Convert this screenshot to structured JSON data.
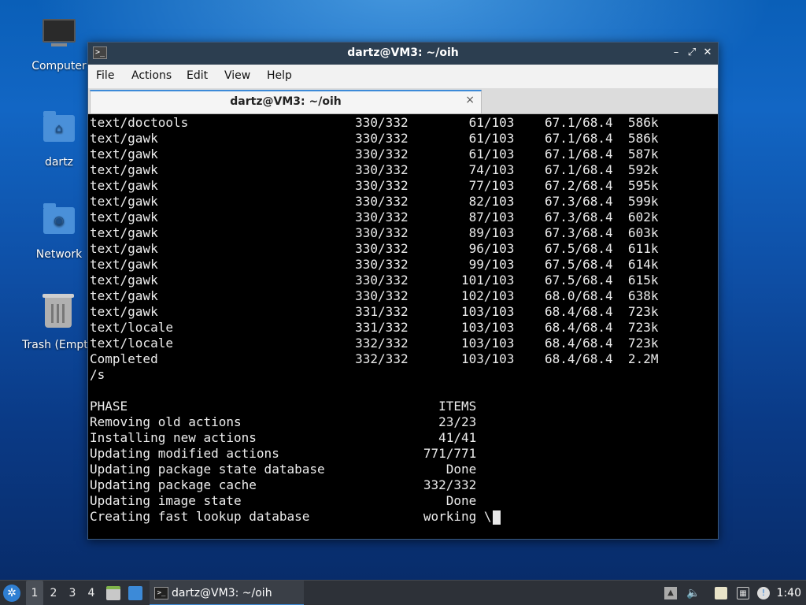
{
  "desktop": {
    "icons": [
      {
        "label": "Computer"
      },
      {
        "label": "dartz"
      },
      {
        "label": "Network"
      },
      {
        "label": "Trash (Empty)"
      }
    ]
  },
  "window": {
    "title": "dartz@VM3: ~/oih",
    "menu": [
      "File",
      "Actions",
      "Edit",
      "View",
      "Help"
    ],
    "tab_label": "dartz@VM3: ~/oih",
    "tab_close": "×",
    "controls": {
      "minimize": "–",
      "maximize": "⤢",
      "close": "✕"
    }
  },
  "terminal": {
    "lines": [
      "text/doctools                      330/332        61/103    67.1/68.4  586k",
      "text/gawk                          330/332        61/103    67.1/68.4  586k",
      "text/gawk                          330/332        61/103    67.1/68.4  587k",
      "text/gawk                          330/332        74/103    67.1/68.4  592k",
      "text/gawk                          330/332        77/103    67.2/68.4  595k",
      "text/gawk                          330/332        82/103    67.3/68.4  599k",
      "text/gawk                          330/332        87/103    67.3/68.4  602k",
      "text/gawk                          330/332        89/103    67.3/68.4  603k",
      "text/gawk                          330/332        96/103    67.5/68.4  611k",
      "text/gawk                          330/332        99/103    67.5/68.4  614k",
      "text/gawk                          330/332       101/103    67.5/68.4  615k",
      "text/gawk                          330/332       102/103    68.0/68.4  638k",
      "text/gawk                          331/332       103/103    68.4/68.4  723k",
      "text/locale                        331/332       103/103    68.4/68.4  723k",
      "text/locale                        332/332       103/103    68.4/68.4  723k",
      "Completed                          332/332       103/103    68.4/68.4  2.2M",
      "/s",
      "",
      "PHASE                                         ITEMS",
      "Removing old actions                          23/23",
      "Installing new actions                        41/41",
      "Updating modified actions                   771/771",
      "Updating package state database                Done",
      "Updating package cache                      332/332",
      "Updating image state                           Done",
      "Creating fast lookup database               working \\"
    ]
  },
  "taskbar": {
    "workspaces": [
      "1",
      "2",
      "3",
      "4"
    ],
    "active_workspace": "1",
    "task_label": "dartz@VM3: ~/oih",
    "clock": "1:40",
    "tray_icons": [
      "eject-icon",
      "volume-icon",
      "clipboard-icon",
      "network-icon",
      "notification-icon"
    ]
  }
}
